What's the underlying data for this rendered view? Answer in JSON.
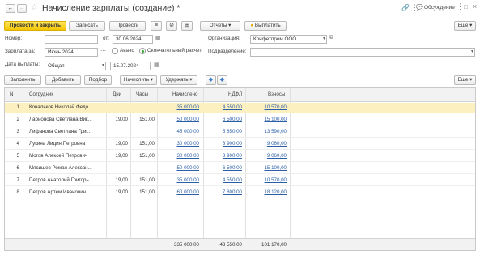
{
  "window": {
    "title": "Начисление зарплаты (создание) *",
    "discussion_label": "Обсуждение"
  },
  "toolbar": {
    "post_close": "Провести и закрыть",
    "save": "Записать",
    "post": "Провести",
    "reports": "Отчеты",
    "pay": "Выплатить",
    "more": "Еще"
  },
  "form": {
    "number_label": "Номер:",
    "number_value": "",
    "from_label": "от:",
    "date_value": "30.06.2024",
    "org_label": "Организация:",
    "org_value": "Конфетпром ООО",
    "salary_for_label": "Зарплата за:",
    "month_value": "Июнь 2024",
    "advance_label": "Аванс",
    "final_label": "Окончательный расчет",
    "department_label": "Подразделение:",
    "department_value": "",
    "paydate_label": "Дата выплаты:",
    "paytype_value": "Общая",
    "paydate_value": "15.07.2024"
  },
  "table_toolbar": {
    "fill": "Заполнить",
    "add": "Добавить",
    "pick": "Подбор",
    "accrue": "Начислить",
    "withhold": "Удержать",
    "more": "Еще"
  },
  "table": {
    "headers": {
      "n": "N",
      "employee": "Сотрудник",
      "days": "Дни",
      "hours": "Часы",
      "accrued": "Начислено",
      "ndfl": "НДФЛ",
      "contrib": "Взносы"
    },
    "rows": [
      {
        "n": "1",
        "employee": "Ковальков Николай Федо...",
        "days": "",
        "hours": "",
        "accrued": "35 000,00",
        "ndfl": "4 550,00",
        "contrib": "10 570,00"
      },
      {
        "n": "2",
        "employee": "Ларионова Светлана Вик...",
        "days": "19,00",
        "hours": "151,00",
        "accrued": "50 000,00",
        "ndfl": "6 500,00",
        "contrib": "15 100,00"
      },
      {
        "n": "3",
        "employee": "Лифанова Светлана Григ...",
        "days": "",
        "hours": "",
        "accrued": "45 000,00",
        "ndfl": "5 850,00",
        "contrib": "13 590,00"
      },
      {
        "n": "4",
        "employee": "Лукина Лидия Петровна",
        "days": "19,00",
        "hours": "151,00",
        "accrued": "30 000,00",
        "ndfl": "3 900,00",
        "contrib": "9 060,00"
      },
      {
        "n": "5",
        "employee": "Могов Алексей Петрович",
        "days": "19,00",
        "hours": "151,00",
        "accrued": "30 000,00",
        "ndfl": "3 900,00",
        "contrib": "9 060,00"
      },
      {
        "n": "6",
        "employee": "Мясищев Роман Алексан...",
        "days": "",
        "hours": "",
        "accrued": "50 000,00",
        "ndfl": "6 500,00",
        "contrib": "15 100,00"
      },
      {
        "n": "7",
        "employee": "Петров Анатолий Григорь...",
        "days": "19,00",
        "hours": "151,00",
        "accrued": "35 000,00",
        "ndfl": "4 550,00",
        "contrib": "10 570,00"
      },
      {
        "n": "8",
        "employee": "Петров Артем Иванович",
        "days": "19,00",
        "hours": "151,00",
        "accrued": "60 000,00",
        "ndfl": "7 800,00",
        "contrib": "18 120,00"
      }
    ],
    "totals": {
      "accrued": "335 000,00",
      "ndfl": "43 550,00",
      "contrib": "101 170,00"
    }
  }
}
